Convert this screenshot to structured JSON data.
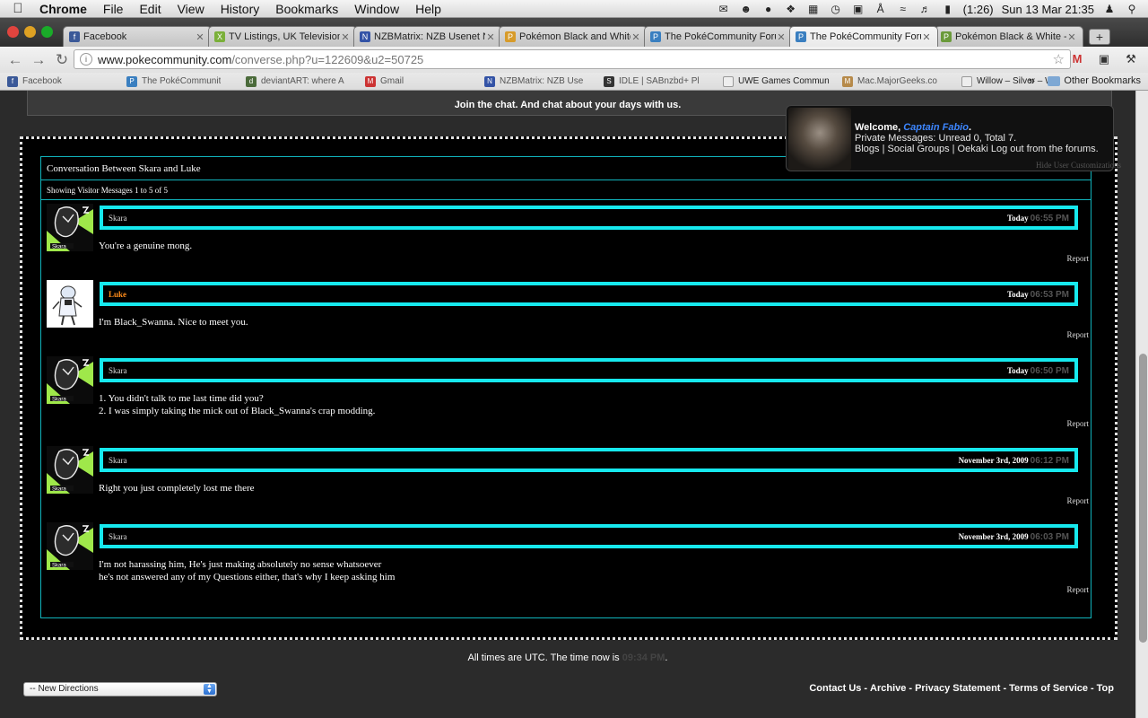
{
  "menubar": {
    "app": "Chrome",
    "items": [
      "File",
      "Edit",
      "View",
      "History",
      "Bookmarks",
      "Window",
      "Help"
    ],
    "battery": "(1:26)",
    "datetime": "Sun 13 Mar  21:35"
  },
  "tabs": [
    {
      "label": "Facebook",
      "icon": "facebook-icon",
      "color": "#3b5998",
      "glyph": "f"
    },
    {
      "label": "TV Listings, UK Television",
      "icon": "tv-icon",
      "color": "#7bb03a",
      "glyph": "X"
    },
    {
      "label": "NZBMatrix: NZB Usenet N",
      "icon": "nzb-icon",
      "color": "#3353a6",
      "glyph": "N"
    },
    {
      "label": "Pokémon Black and White",
      "icon": "pokemon-icon",
      "color": "#d79b2a",
      "glyph": "P"
    },
    {
      "label": "The PokéCommunity Foru",
      "icon": "pc-icon",
      "color": "#3a7fc0",
      "glyph": "P"
    },
    {
      "label": "The PokéCommunity Foru",
      "icon": "pc-icon",
      "color": "#3a7fc0",
      "glyph": "P",
      "active": true
    },
    {
      "label": "Pokémon Black & White -",
      "icon": "pokemon-icon",
      "color": "#6a9a3a",
      "glyph": "P"
    }
  ],
  "newtab": "+",
  "address": {
    "host": "www.pokecommunity.com",
    "path": "/converse.php?u=122609&u2=50725"
  },
  "bookmarks": [
    {
      "label": "Facebook",
      "color": "#3b5998",
      "glyph": "f"
    },
    {
      "label": "The PokéCommunit",
      "color": "#3a7fc0",
      "glyph": "P"
    },
    {
      "label": "deviantART: where A",
      "color": "#4b6b3b",
      "glyph": "d"
    },
    {
      "label": "Gmail",
      "color": "#c33",
      "glyph": "M"
    },
    {
      "label": "NZBMatrix: NZB Use",
      "color": "#3353a6",
      "glyph": "N"
    },
    {
      "label": "IDLE | SABnzbd+ Pl",
      "color": "#333",
      "glyph": "S"
    },
    {
      "label": "UWE Games Commun",
      "color": "#eee",
      "glyph": ""
    },
    {
      "label": "Mac.MajorGeeks.co",
      "color": "#b68a4a",
      "glyph": "M"
    },
    {
      "label": "Willow – Silver – Will",
      "color": "#eee",
      "glyph": ""
    }
  ],
  "other_bookmarks": "Other Bookmarks",
  "page": {
    "chat_banner": "Join the chat. And chat about your days with us.",
    "welcome": {
      "greeting": "Welcome,",
      "username": "Captain Fabio",
      "pm_label": "Private Messages:",
      "pm_value": "Unread 0, Total 7.",
      "links": "Blogs | Social Groups | Oekaki Log out from the forums."
    },
    "hide_customizations": "Hide User Customizations",
    "conversation_title": "Conversation Between Skara and Luke",
    "showing": "Showing Visitor Messages 1 to 5 of 5",
    "messages": [
      {
        "author": "Skara",
        "date": "Today",
        "time": "06:55 PM",
        "body": "You're a genuine mong.",
        "avatar": "skara"
      },
      {
        "author": "Luke",
        "date": "Today",
        "time": "06:53 PM",
        "body": "I'm Black_Swanna. Nice to meet you.",
        "avatar": "luke"
      },
      {
        "author": "Skara",
        "date": "Today",
        "time": "06:50 PM",
        "body": "1. You didn't talk to me last time did you?\n2. I was simply taking the mick out of Black_Swanna's crap modding.",
        "avatar": "skara"
      },
      {
        "author": "Skara",
        "date": "November 3rd, 2009",
        "time": "06:12 PM",
        "body": "Right you just completely lost me there",
        "avatar": "skara"
      },
      {
        "author": "Skara",
        "date": "November 3rd, 2009",
        "time": "06:03 PM",
        "body": "I'm not harassing him, He's just making absolutely no sense whatsoever\nhe's not answered any of my Questions either, that's why I keep asking him",
        "avatar": "skara"
      }
    ],
    "report_label": "Report",
    "footer_time_prefix": "All times are UTC. The time now is",
    "footer_time_value": "09:34 PM",
    "footer_time_suffix": ".",
    "style_select": "-- New Directions",
    "footer_links": [
      "Contact Us",
      "Archive",
      "Privacy Statement",
      "Terms of Service",
      "Top"
    ]
  },
  "colors": {
    "accent_cyan": "#16e9ee",
    "frame_teal": "#11b4bc",
    "luke_orange": "#ff8c1a",
    "username_blue": "#3d86ff"
  }
}
